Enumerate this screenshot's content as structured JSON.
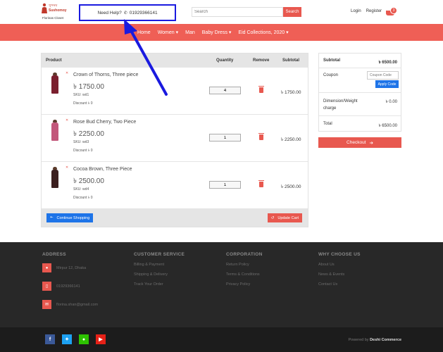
{
  "header": {
    "logo_bengali": "সুসময়",
    "logo_brand": "Sushomoy",
    "logo_tagline": "Florinas Closet",
    "help_label": "Need Help?",
    "help_phone": "01929366141",
    "search_placeholder": "Search",
    "search_button": "Search",
    "login": "Login",
    "register": "Register",
    "cart_count": "3"
  },
  "nav": [
    {
      "label": "Home"
    },
    {
      "label": "Women ▾"
    },
    {
      "label": "Man"
    },
    {
      "label": "Baby Dress ▾"
    },
    {
      "label": "Eid Collections, 2020 ▾"
    }
  ],
  "cart_table": {
    "headers": {
      "product": "Product",
      "quantity": "Quantity",
      "remove": "Remove",
      "subtotal": "Subtotal"
    },
    "items": [
      {
        "name": "Crown of Thorns, Three piece",
        "price": "৳ 1750.00",
        "sku": "SKU: wd1",
        "discount": "Discount ৳ 0",
        "qty": "4",
        "subtotal": "৳ 1750.00",
        "dress_color": "#7a1f2e"
      },
      {
        "name": "Rose Bud Cherry, Two Piece",
        "price": "৳ 2250.00",
        "sku": "SKU: wd3",
        "discount": "Discount ৳ 0",
        "qty": "1",
        "subtotal": "৳ 2250.00",
        "dress_color": "#c2577a"
      },
      {
        "name": "Cocoa Brown, Three Piece",
        "price": "৳ 2500.00",
        "sku": "SKU: wd4",
        "discount": "Discount ৳ 0",
        "qty": "1",
        "subtotal": "৳ 2500.00",
        "dress_color": "#3b1f1f"
      }
    ],
    "continue_label": "Continue Shopping",
    "update_label": "Update Cart"
  },
  "summary": {
    "subtotal_label": "Subtotal",
    "subtotal_value": "৳ 6500.00",
    "coupon_label": "Coupon",
    "coupon_placeholder": "Coupon Code",
    "apply_label": "Apply Code",
    "dimension_label": "Dimension/Weight charge",
    "dimension_value": "৳ 0.00",
    "total_label": "Total",
    "total_value": "৳ 6500.00",
    "checkout_label": "Checkout"
  },
  "footer": {
    "address_head": "ADDRESS",
    "address": "Mirpur 12, Dhaka",
    "phone": "01929366141",
    "email": "florina.shan@gmail.com",
    "customer_head": "CUSTOMER SERVICE",
    "customer_links": [
      "Billing & Payment",
      "Shipping & Delivery",
      "Track Your Order"
    ],
    "corp_head": "CORPORATION",
    "corp_links": [
      "Return Policy",
      "Terms & Conditions",
      "Privacy Policy"
    ],
    "why_head": "WHY CHOOSE US",
    "why_links": [
      "About Us",
      "News & Events",
      "Contact Us"
    ],
    "powered_prefix": "Powered by",
    "powered_brand": "Deshi Commerce"
  },
  "colors": {
    "accent": "#ef5f56",
    "blue": "#1e74e8",
    "annotation": "#1a1adf"
  }
}
